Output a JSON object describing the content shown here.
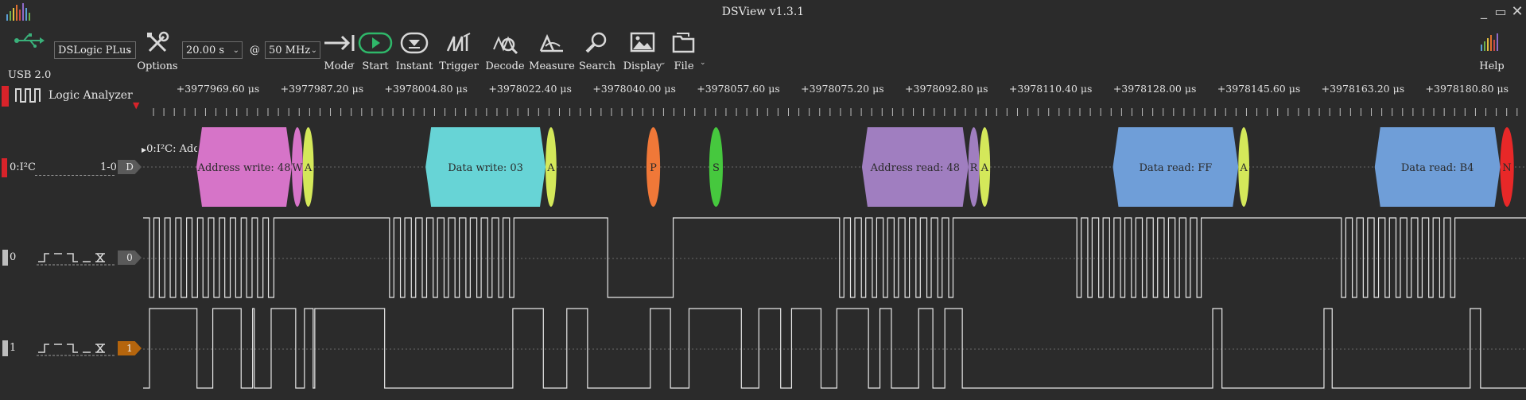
{
  "window": {
    "title": "DSView v1.3.1",
    "minimize": "_",
    "restore": "▭",
    "close": "✕"
  },
  "toolbar": {
    "usb_label": "USB 2.0",
    "device": "DSLogic PLus",
    "options_label": "Options",
    "duration": "20.00 s",
    "at": "@",
    "rate": "50 MHz",
    "mode_label": "Mode",
    "start_label": "Start",
    "instant_label": "Instant",
    "trigger_label": "Trigger",
    "decode_label": "Decode",
    "measure_label": "Measure",
    "search_label": "Search",
    "display_label": "Display",
    "file_label": "File",
    "help_label": "Help"
  },
  "view": {
    "title": "Logic Analyzer",
    "unit": "μs"
  },
  "ruler": {
    "ticks": [
      "+3977969.60",
      "+3977987.20",
      "+3978004.80",
      "+3978022.40",
      "+3978040.00",
      "+3978057.60",
      "+3978075.20",
      "+3978092.80",
      "+3978110.40",
      "+3978128.00",
      "+3978145.60",
      "+3978163.20",
      "+3978180.80"
    ]
  },
  "decoder": {
    "name": "0:I²C",
    "range": "1-0",
    "tag": "D",
    "overlay": "0:I²C: Add",
    "segments": [
      {
        "text": "Address write: 48",
        "color": "#d674c8",
        "start": 0.0,
        "end": 17.5
      },
      {
        "text": "W",
        "color": "#d674c8",
        "start": 17.5,
        "end": 19.5
      },
      {
        "text": "A",
        "color": "#d4e85a",
        "start": 19.5,
        "end": 21.5
      },
      {
        "text": "Data write: 03",
        "color": "#67d4d6",
        "start": 42.0,
        "end": 64.0
      },
      {
        "text": "A",
        "color": "#d4e85a",
        "start": 64.0,
        "end": 66.0
      },
      {
        "text": "P",
        "color": "#f07838",
        "start": 82.5,
        "end": 85.0
      },
      {
        "text": "S",
        "color": "#46c83e",
        "start": 94.0,
        "end": 96.5
      },
      {
        "text": "Address read: 48",
        "color": "#a07ec0",
        "start": 122.0,
        "end": 141.5
      },
      {
        "text": "R",
        "color": "#a07ec0",
        "start": 141.5,
        "end": 143.5
      },
      {
        "text": "A",
        "color": "#d4e85a",
        "start": 143.5,
        "end": 145.5
      },
      {
        "text": "Data read: FF",
        "color": "#6f9ed8",
        "start": 168.0,
        "end": 191.0
      },
      {
        "text": "A",
        "color": "#d4e85a",
        "start": 191.0,
        "end": 193.0
      },
      {
        "text": "Data read: B4",
        "color": "#6f9ed8",
        "start": 216.0,
        "end": 239.0
      },
      {
        "text": "N",
        "color": "#e82828",
        "start": 239.0,
        "end": 241.5
      }
    ]
  },
  "channels": [
    {
      "name": "0",
      "tag": "0",
      "tag_color": "#5a5a5a",
      "marker_color": "#bdbdbd",
      "level_transitions": [
        0,
        0.8,
        1.8,
        2.8,
        3.8,
        4.8,
        5.8,
        6.8,
        7.8,
        8.8,
        9.8,
        10.8,
        11.8,
        12.8,
        13.8,
        14.8,
        15.8,
        16.8,
        17.8,
        18.8,
        19.8,
        20.8,
        21.8,
        22.8,
        44,
        44.8,
        46,
        46.8,
        48,
        48.8,
        50,
        50.8,
        52,
        52.8,
        54,
        54.8,
        56,
        56.8,
        58,
        58.8,
        60,
        60.8,
        62,
        62.8,
        64,
        64.8,
        66,
        66.8,
        84,
        96,
        126.5,
        127.3,
        128.5,
        129.3,
        130.5,
        131.3,
        132.5,
        133.3,
        134.5,
        135.3,
        136.5,
        137.3,
        138.5,
        139.3,
        140.5,
        141.3,
        142.5,
        143.3,
        144.5,
        145.3,
        146.5,
        147.3,
        170,
        170.8,
        172,
        172.8,
        174,
        174.8,
        176,
        176.8,
        178,
        178.8,
        180,
        180.8,
        182,
        182.8,
        184,
        184.8,
        186,
        186.8,
        188,
        188.8,
        190,
        190.8,
        192,
        192.8,
        218.5,
        219.3,
        220.5,
        221.3,
        222.5,
        223.3,
        224.5,
        225.3,
        226.5,
        227.3,
        228.5,
        229.3,
        230.5,
        231.3,
        232.5,
        233.3,
        234.5,
        235.3,
        236.5,
        237.3,
        238.5,
        239.3
      ]
    },
    {
      "name": "1",
      "tag": "1",
      "tag_color": "#b5650d",
      "marker_color": "#bdbdbd",
      "level_transitions": [
        0,
        8.7,
        11.6,
        16.8,
        18.9,
        19.2,
        22.3,
        26.8,
        28.4,
        30.0,
        30.3,
        43.1,
        66.6,
        72.2,
        76.5,
        80.3,
        91.8,
        95.5,
        98.9,
        108.5,
        111.7,
        115.7,
        117.7,
        123.1,
        126.0,
        131.8,
        133.9,
        136.0,
        141.0,
        143.6,
        145.8,
        149.0,
        194.9,
        196.6,
        215.3,
        216.8,
        242.1,
        244.0
      ]
    }
  ]
}
